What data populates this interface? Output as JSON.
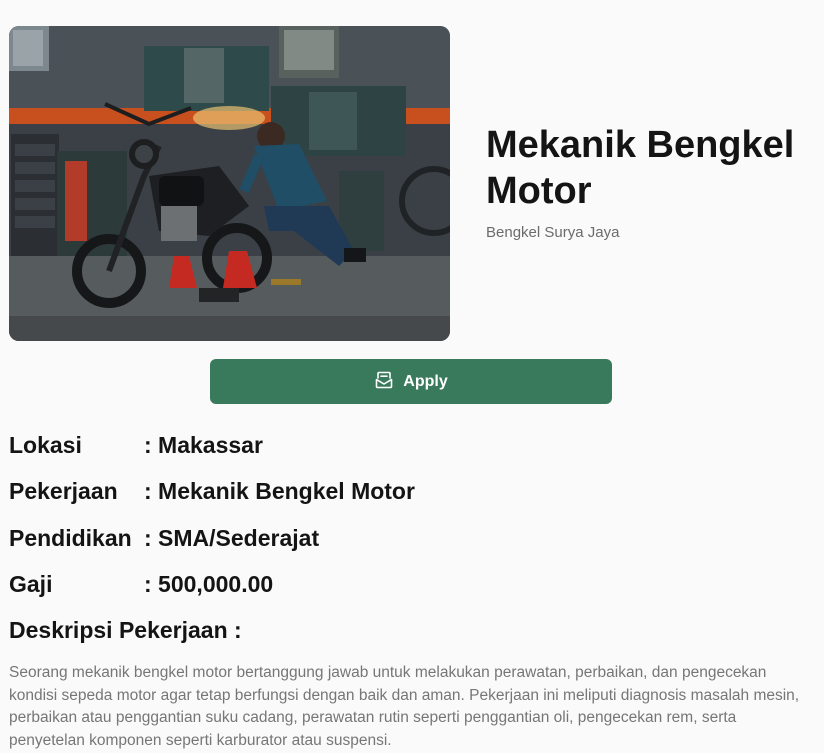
{
  "job": {
    "title": "Mekanik Bengkel Motor",
    "company": "Bengkel Surya Jaya",
    "apply_label": "Apply"
  },
  "details": [
    {
      "key": "Lokasi",
      "value": ": Makassar"
    },
    {
      "key": "Pekerjaan",
      "value": ": Mekanik Bengkel Motor"
    },
    {
      "key": "Pendidikan",
      "value": ": SMA/Sederajat"
    },
    {
      "key": "Gaji",
      "value": ": 500,000.00"
    }
  ],
  "description": {
    "heading": "Deskripsi Pekerjaan :",
    "text": "Seorang mekanik bengkel motor bertanggung jawab untuk melakukan perawatan, perbaikan, dan pengecekan kondisi sepeda motor agar tetap berfungsi dengan baik dan aman. Pekerjaan ini meliputi diagnosis masalah mesin, perbaikan atau penggantian suku cadang, perawatan rutin seperti penggantian oli, pengecekan rem, serta penyetelan komponen seperti karburator atau suspensi."
  },
  "colors": {
    "accent": "#3a7a5c",
    "title": "#141414",
    "muted": "#767676",
    "background": "#fafafa"
  },
  "icons": {
    "apply": "inbox-apply-icon"
  }
}
